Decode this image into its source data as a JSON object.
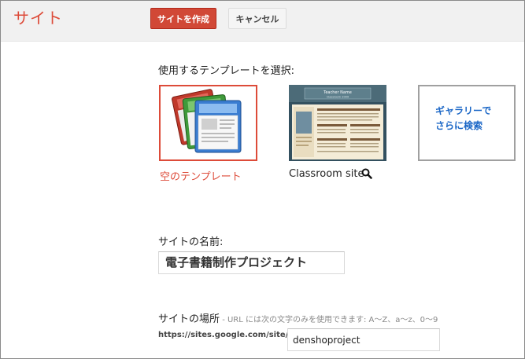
{
  "header": {
    "app_title": "サイト",
    "create_button": "サイトを作成",
    "cancel_button": "キャンセル"
  },
  "templates": {
    "prompt": "使用するテンプレートを選択:",
    "items": [
      {
        "label": "空のテンプレート",
        "selected": true
      },
      {
        "label": "Classroom site",
        "selected": false
      },
      {
        "label": "ギャラリーでさらに検索",
        "line1": "ギャラリーで",
        "line2": "さらに検索"
      }
    ],
    "classroom_thumb_title": "Teacher Name",
    "classroom_thumb_subtitle": "Classroom 2009"
  },
  "site_name": {
    "label": "サイトの名前:",
    "value": "電子書籍制作プロジェクト"
  },
  "site_location": {
    "label": "サイトの場所",
    "separator": " - ",
    "hint_url": "URL",
    "hint_rest": " には次の文字のみを使用できます: A〜Z、a〜z、0〜9",
    "url_prefix": "https://sites.google.com/site/",
    "value": "denshoproject"
  },
  "colors": {
    "accent_red": "#dd4b39",
    "create_button_bg": "#d14836",
    "gallery_link_blue": "#1a66c6"
  },
  "icons": {
    "blank_template": "stacked-documents-icon",
    "preview": "magnifier-icon"
  }
}
